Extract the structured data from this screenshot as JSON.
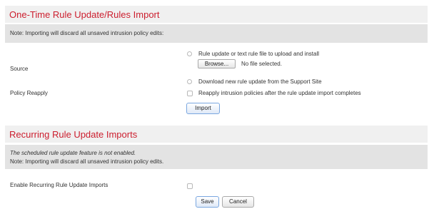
{
  "one_time": {
    "title": "One-Time Rule Update/Rules Import",
    "note": "Note: Importing will discard all unsaved intrusion policy edits:",
    "source_label": "Source",
    "source_options": [
      "Rule update or text rule file to upload and install",
      "Download new rule update from the Support Site"
    ],
    "browse_label": "Browse...",
    "file_status": "No file selected.",
    "reapply_label": "Policy Reapply",
    "reapply_option": "Reapply intrusion policies after the rule update import completes",
    "import_label": "Import"
  },
  "recurring": {
    "title": "Recurring Rule Update Imports",
    "disabled_note": "The scheduled rule update feature is not enabled.",
    "note": "Note: Importing will discard all unsaved intrusion policy edits.",
    "enable_label": "Enable Recurring Rule Update Imports",
    "save_label": "Save",
    "cancel_label": "Cancel"
  },
  "colors": {
    "title": "#cc1e2e",
    "note_band": "#e3e3e3",
    "header_band": "#f0f0f0"
  }
}
